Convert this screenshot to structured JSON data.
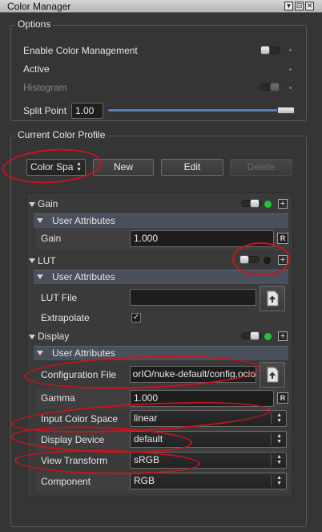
{
  "window": {
    "title": "Color Manager",
    "buttons": [
      "▾",
      "⊟",
      "✕"
    ]
  },
  "options": {
    "group_title": "Options",
    "enable_label": "Enable Color Management",
    "active_label": "Active",
    "histogram_label": "Histogram",
    "split_point_label": "Split Point",
    "split_point_value": "1.00",
    "split_point_fraction": 0.97
  },
  "profile": {
    "group_title": "Current Color Profile",
    "color_space_combo": "Color Spa",
    "new_label": "New",
    "edit_label": "Edit",
    "delete_label": "Delete"
  },
  "gain": {
    "title": "Gain",
    "user_attributes": "User Attributes",
    "field_label": "Gain",
    "field_value": "1.000",
    "r_label": "R",
    "plus": "+"
  },
  "lut": {
    "title": "LUT",
    "user_attributes": "User Attributes",
    "file_label": "LUT File",
    "file_value": "",
    "extrapolate_label": "Extrapolate",
    "extrapolate_check": "✓",
    "plus": "+"
  },
  "display": {
    "title": "Display",
    "user_attributes": "User Attributes",
    "config_label": "Configuration File",
    "config_value": "orIO/nuke-default/config.ocio",
    "gamma_label": "Gamma",
    "gamma_value": "1.000",
    "r_label": "R",
    "input_cs_label": "Input Color Space",
    "input_cs_value": "linear",
    "device_label": "Display Device",
    "device_value": "default",
    "view_label": "View Transform",
    "view_value": "sRGB",
    "component_label": "Component",
    "component_value": "RGB",
    "plus": "+"
  },
  "colors": {
    "led_on": "#22c33a",
    "led_off": "#1c1c1c",
    "annotation": "#c8141c",
    "accent": "#5a7fb8"
  }
}
